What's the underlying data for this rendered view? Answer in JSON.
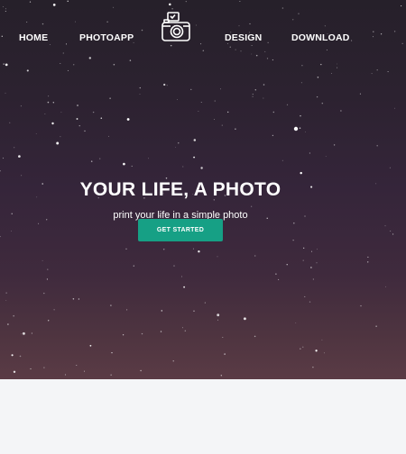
{
  "nav": {
    "items": [
      {
        "label": "HOME"
      },
      {
        "label": "PHOTOAPP"
      },
      {
        "label": "DESIGN"
      },
      {
        "label": "DOWNLOAD"
      }
    ],
    "logo_icon": "camera-icon"
  },
  "hero": {
    "title": "YOUR LIFE, A PHOTO",
    "subtitle": "print your life in a simple photo",
    "cta_label": "GET STARTED",
    "background": "night-sky-stars"
  },
  "colors": {
    "accent": "#16a085",
    "sky_top": "#26202a",
    "sky_bottom": "#5a3b45",
    "below_fold": "#f4f5f7",
    "text": "#ffffff"
  }
}
